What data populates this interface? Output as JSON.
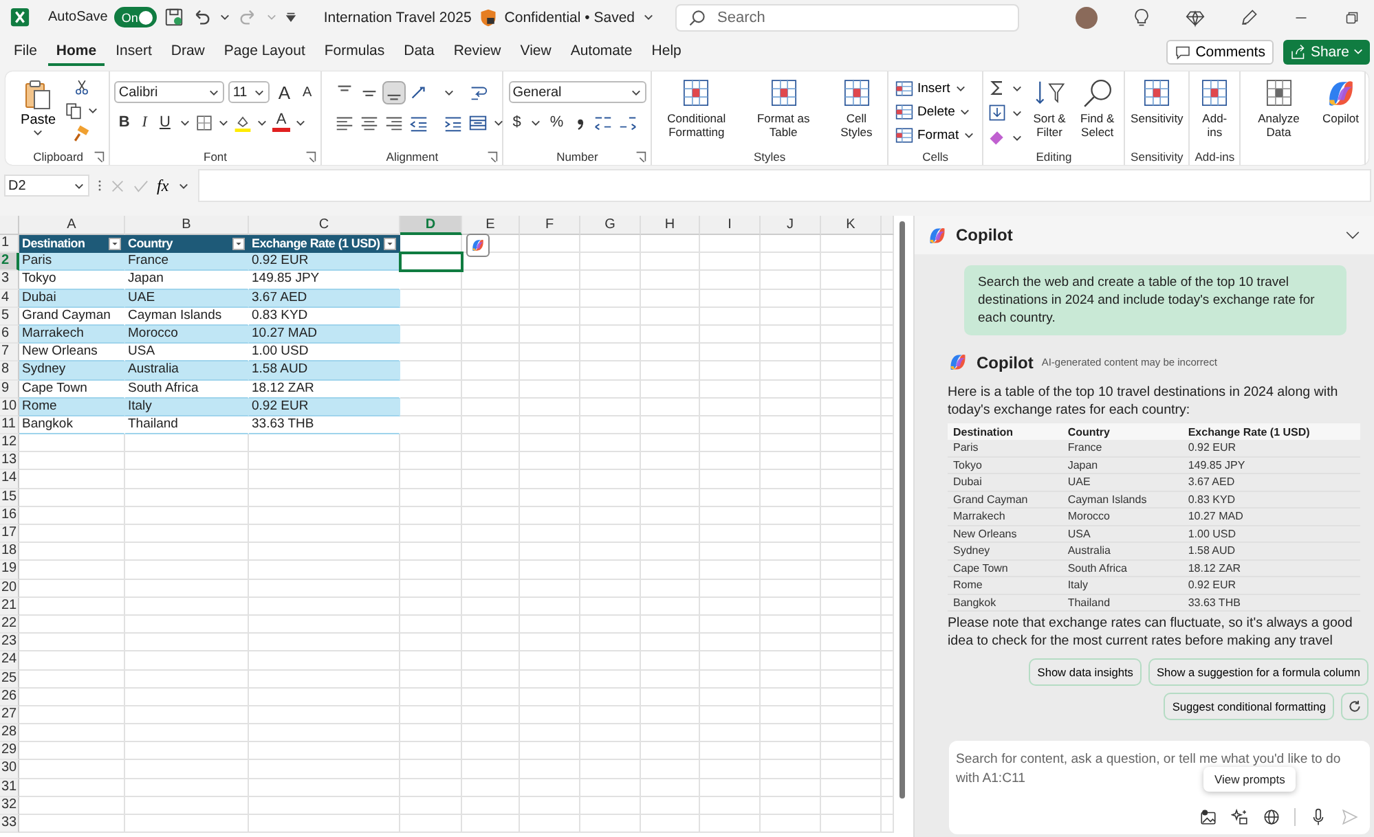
{
  "title_bar": {
    "autosave_label": "AutoSave",
    "autosave": {
      "label": "On",
      "on": true
    },
    "document_title": "Internation Travel 2025",
    "status": "Confidential • Saved",
    "search": {
      "placeholder": "Search"
    }
  },
  "menu_tabs": [
    {
      "label": "File",
      "selected": false
    },
    {
      "label": "Home",
      "selected": true
    },
    {
      "label": "Insert",
      "selected": false
    },
    {
      "label": "Draw",
      "selected": false
    },
    {
      "label": "Page Layout",
      "selected": false
    },
    {
      "label": "Formulas",
      "selected": false
    },
    {
      "label": "Data",
      "selected": false
    },
    {
      "label": "Review",
      "selected": false
    },
    {
      "label": "View",
      "selected": false
    },
    {
      "label": "Automate",
      "selected": false
    },
    {
      "label": "Help",
      "selected": false
    }
  ],
  "comments_button": "Comments",
  "share_button": "Share",
  "ribbon": {
    "groups": [
      {
        "kind": "clipboard",
        "label": "Clipboard",
        "paste": "Paste"
      },
      {
        "kind": "font",
        "label": "Font",
        "font_name": "Calibri",
        "font_size": "11",
        "grow": "A",
        "shrink": "A",
        "bold": "B",
        "italic": "I",
        "underline": "U",
        "font_color": "A"
      },
      {
        "kind": "alignment",
        "label": "Alignment"
      },
      {
        "kind": "number",
        "label": "Number",
        "format": "General",
        "currency": "$",
        "percent": "%"
      },
      {
        "kind": "large",
        "label": "Styles",
        "commands": [
          "Conditional Formatting",
          "Format as Table",
          "Cell Styles"
        ]
      },
      {
        "kind": "cells",
        "label": "Cells",
        "commands": [
          "Insert",
          "Delete",
          "Format"
        ]
      },
      {
        "kind": "editing",
        "label": "Editing",
        "commands": [
          "Sort & Filter",
          "Find & Select"
        ]
      },
      {
        "kind": "large",
        "label": "Sensitivity",
        "commands": [
          "Sensitivity"
        ]
      },
      {
        "kind": "large",
        "label": "Add-ins",
        "commands": [
          "Add-ins"
        ]
      },
      {
        "kind": "large",
        "commands": [
          "Analyze Data",
          "Copilot"
        ]
      }
    ]
  },
  "formula_bar": {
    "name_box": "D2",
    "function_symbol": "fx"
  },
  "sheet": {
    "columns": [
      {
        "label": "A",
        "selected": false
      },
      {
        "label": "B",
        "selected": false
      },
      {
        "label": "C",
        "selected": false
      },
      {
        "label": "D",
        "selected": true
      },
      {
        "label": "E",
        "selected": false
      },
      {
        "label": "F",
        "selected": false
      },
      {
        "label": "G",
        "selected": false
      },
      {
        "label": "H",
        "selected": false
      },
      {
        "label": "I",
        "selected": false
      },
      {
        "label": "J",
        "selected": false
      },
      {
        "label": "K",
        "selected": false
      }
    ],
    "row_numbers": [
      {
        "label": "1",
        "selected": false
      },
      {
        "label": "2",
        "selected": true
      },
      {
        "label": "3",
        "selected": false
      },
      {
        "label": "4",
        "selected": false
      },
      {
        "label": "5",
        "selected": false
      },
      {
        "label": "6",
        "selected": false
      },
      {
        "label": "7",
        "selected": false
      },
      {
        "label": "8",
        "selected": false
      },
      {
        "label": "9",
        "selected": false
      },
      {
        "label": "10",
        "selected": false
      },
      {
        "label": "11",
        "selected": false
      },
      {
        "label": "12",
        "selected": false
      },
      {
        "label": "13",
        "selected": false
      },
      {
        "label": "14",
        "selected": false
      },
      {
        "label": "15",
        "selected": false
      },
      {
        "label": "16",
        "selected": false
      },
      {
        "label": "17",
        "selected": false
      },
      {
        "label": "18",
        "selected": false
      },
      {
        "label": "19",
        "selected": false
      },
      {
        "label": "20",
        "selected": false
      },
      {
        "label": "21",
        "selected": false
      },
      {
        "label": "22",
        "selected": false
      },
      {
        "label": "23",
        "selected": false
      },
      {
        "label": "24",
        "selected": false
      },
      {
        "label": "25",
        "selected": false
      },
      {
        "label": "26",
        "selected": false
      },
      {
        "label": "27",
        "selected": false
      },
      {
        "label": "28",
        "selected": false
      },
      {
        "label": "29",
        "selected": false
      },
      {
        "label": "30",
        "selected": false
      },
      {
        "label": "31",
        "selected": false
      },
      {
        "label": "32",
        "selected": false
      },
      {
        "label": "33",
        "selected": false
      }
    ],
    "table": {
      "columns": [
        "Destination",
        "Country",
        "Exchange Rate (1 USD)"
      ],
      "rows": [
        [
          "Paris",
          "France",
          "0.92 EUR"
        ],
        [
          "Tokyo",
          "Japan",
          "149.85 JPY"
        ],
        [
          "Dubai",
          "UAE",
          "3.67 AED"
        ],
        [
          "Grand Cayman",
          "Cayman Islands",
          "0.83 KYD"
        ],
        [
          "Marrakech",
          "Morocco",
          "10.27 MAD"
        ],
        [
          "New Orleans",
          "USA",
          "1.00 USD"
        ],
        [
          "Sydney",
          "Australia",
          "1.58 AUD"
        ],
        [
          "Cape Town",
          "South Africa",
          "18.12 ZAR"
        ],
        [
          "Rome",
          "Italy",
          "0.92 EUR"
        ],
        [
          "Bangkok",
          "Thailand",
          "33.63 THB"
        ]
      ]
    }
  },
  "copilot": {
    "title": "Copilot",
    "user_message": "Search the web and create a table of the top 10 travel destinations in 2024 and include today's exchange rate for each country.",
    "reply": {
      "sender": "Copilot",
      "disclaimer": "AI-generated content may be incorrect",
      "intro": "Here is a table of the top 10 travel destinations in 2024 along with today's exchange rates for each country:",
      "table": {
        "columns": [
          "Destination",
          "Country",
          "Exchange Rate (1 USD)"
        ],
        "rows": [
          [
            "Paris",
            "France",
            "0.92 EUR"
          ],
          [
            "Tokyo",
            "Japan",
            "149.85 JPY"
          ],
          [
            "Dubai",
            "UAE",
            "3.67 AED"
          ],
          [
            "Grand Cayman",
            "Cayman Islands",
            "0.83 KYD"
          ],
          [
            "Marrakech",
            "Morocco",
            "10.27 MAD"
          ],
          [
            "New Orleans",
            "USA",
            "1.00 USD"
          ],
          [
            "Sydney",
            "Australia",
            "1.58 AUD"
          ],
          [
            "Cape Town",
            "South Africa",
            "18.12 ZAR"
          ],
          [
            "Rome",
            "Italy",
            "0.92 EUR"
          ],
          [
            "Bangkok",
            "Thailand",
            "33.63 THB"
          ]
        ]
      },
      "note": "Please note that exchange rates can fluctuate, so it's always a good idea to check for the most current rates before making any travel"
    },
    "suggestions": [
      "Show data insights",
      "Show a suggestion for a formula column",
      "Suggest conditional formatting"
    ],
    "input": {
      "placeholder": "Search for content, ask a question, or tell me what you'd like to do with A1:C11"
    },
    "tooltip": "View prompts"
  }
}
